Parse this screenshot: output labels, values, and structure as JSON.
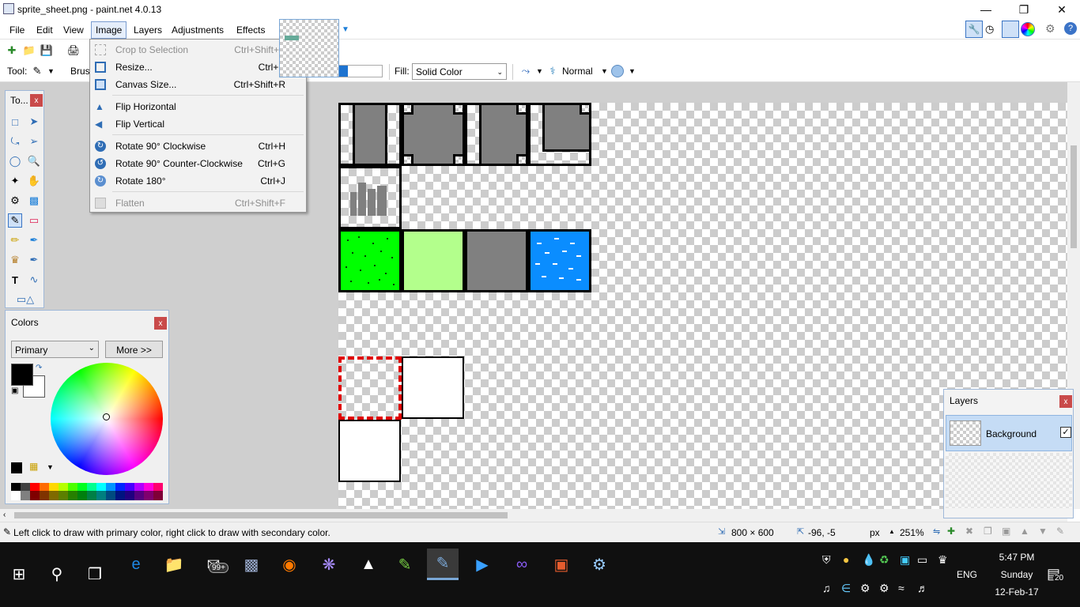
{
  "window": {
    "title": "sprite_sheet.png - paint.net 4.0.13"
  },
  "menubar": {
    "items": [
      "File",
      "Edit",
      "View",
      "Image",
      "Layers",
      "Adjustments",
      "Effects"
    ],
    "active": "Image"
  },
  "image_menu": {
    "items": [
      {
        "label": "Crop to Selection",
        "shortcut": "Ctrl+Shift+X",
        "enabled": false,
        "icon": "crop-icon"
      },
      {
        "label": "Resize...",
        "shortcut": "Ctrl+R",
        "enabled": true,
        "icon": "resize-icon"
      },
      {
        "label": "Canvas Size...",
        "shortcut": "Ctrl+Shift+R",
        "enabled": true,
        "icon": "canvas-size-icon"
      },
      {
        "label": "Flip Horizontal",
        "shortcut": "",
        "enabled": true,
        "icon": "flip-horizontal-icon"
      },
      {
        "label": "Flip Vertical",
        "shortcut": "",
        "enabled": true,
        "icon": "flip-vertical-icon"
      },
      {
        "label": "Rotate 90° Clockwise",
        "shortcut": "Ctrl+H",
        "enabled": true,
        "icon": "rotate-cw-icon"
      },
      {
        "label": "Rotate 90° Counter-Clockwise",
        "shortcut": "Ctrl+G",
        "enabled": true,
        "icon": "rotate-ccw-icon"
      },
      {
        "label": "Rotate 180°",
        "shortcut": "Ctrl+J",
        "enabled": true,
        "icon": "rotate-180-icon"
      },
      {
        "label": "Flatten",
        "shortcut": "Ctrl+Shift+F",
        "enabled": false,
        "icon": "flatten-icon"
      }
    ]
  },
  "toolbar": {
    "tool_label": "Tool:",
    "brush_label": "Brus",
    "fill_label": "Fill:",
    "fill_value": "Solid Color",
    "blend_value": "Normal"
  },
  "tools_panel": {
    "title": "To...",
    "close": "x"
  },
  "colors_panel": {
    "title": "Colors",
    "close": "x",
    "mode_value": "Primary",
    "more_label": "More >>",
    "primary_color": "#000000",
    "secondary_color": "#ffffff",
    "palette_top": [
      "#000000",
      "#404040",
      "#ff0000",
      "#ff6a00",
      "#ffd800",
      "#b6ff00",
      "#4cff00",
      "#00ff21",
      "#00ff90",
      "#00ffff",
      "#0094ff",
      "#0026ff",
      "#4800ff",
      "#b200ff",
      "#ff00dc",
      "#ff006e"
    ],
    "palette_bottom": [
      "#ffffff",
      "#808080",
      "#7f0000",
      "#7f3300",
      "#7f6a00",
      "#5b7f00",
      "#267f00",
      "#007f0e",
      "#007f46",
      "#007f7f",
      "#004a7f",
      "#00137f",
      "#21007f",
      "#57007f",
      "#7f006e",
      "#7f0037"
    ]
  },
  "layers_panel": {
    "title": "Layers",
    "close": "x",
    "layer_name": "Background",
    "layer_visible": true
  },
  "status": {
    "hint": "Left click to draw with primary color, right click to draw with secondary color.",
    "image_size": "800 × 600",
    "cursor_pos": "-96, -5",
    "units": "px",
    "zoom": "251%"
  },
  "taskbar": {
    "badge": "99+",
    "lang": "ENG",
    "time": "5:47 PM",
    "day": "Sunday",
    "date": "12-Feb-17",
    "notifications": "20"
  }
}
